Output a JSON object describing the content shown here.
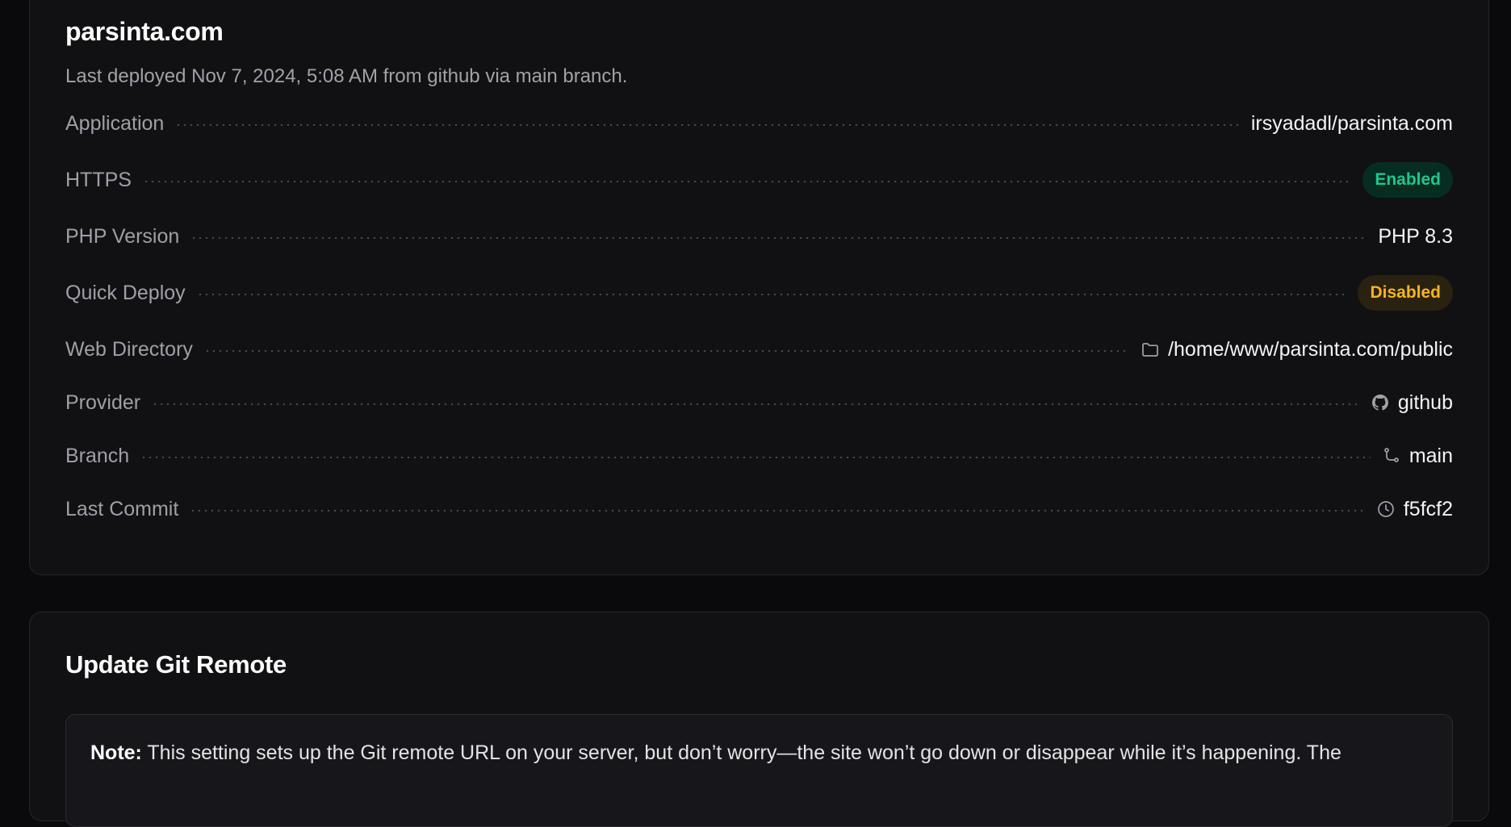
{
  "site": {
    "title": "parsinta.com",
    "subtitle": "Last deployed Nov 7, 2024, 5:08 AM from github via main branch.",
    "rows": [
      {
        "label": "Application",
        "value": "irsyadadl/parsinta.com"
      },
      {
        "label": "HTTPS",
        "value": "Enabled",
        "badge": "success",
        "color": "#22c58e"
      },
      {
        "label": "PHP Version",
        "value": "PHP 8.3"
      },
      {
        "label": "Quick Deploy",
        "value": "Disabled",
        "badge": "warning",
        "color": "#f5b423"
      },
      {
        "label": "Web Directory",
        "value": "/home/www/parsinta.com/public",
        "icon": "folder-icon"
      },
      {
        "label": "Provider",
        "value": "github",
        "icon": "github-icon"
      },
      {
        "label": "Branch",
        "value": "main",
        "icon": "git-branch-icon"
      },
      {
        "label": "Last Commit",
        "value": "f5fcf2",
        "icon": "clock-icon"
      }
    ]
  },
  "git_remote": {
    "title": "Update Git Remote",
    "note_label": "Note:",
    "note_text": "This setting sets up the Git remote URL on your server, but don’t worry—the site won’t go down or disappear while it’s happening. The"
  }
}
